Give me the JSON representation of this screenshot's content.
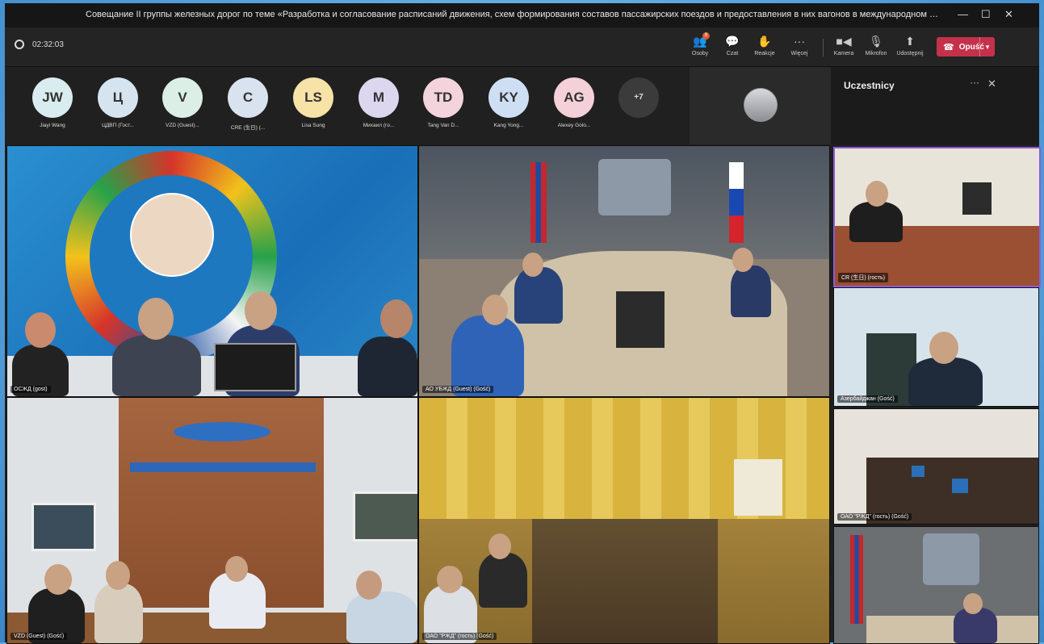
{
  "window": {
    "title": "Совещание II группы железных дорог по теме «Разработка и согласование расписаний движения, схем формирования составов пассажирских поездов и предоставления в них вагонов в международном сообщении на..."
  },
  "toolbar": {
    "timer": "02:32:03",
    "people_label": "Osoby",
    "chat_label": "Czat",
    "reactions_label": "Reakcje",
    "more_label": "Więcej",
    "camera_label": "Kamera",
    "mic_label": "Mikrofon",
    "share_label": "Udostępnij",
    "leave_label": "Opuść",
    "people_badge": "8"
  },
  "participants_strip": [
    {
      "initials": "JW",
      "name": "Jiayi Wang",
      "color": "#d9ecef"
    },
    {
      "initials": "Ц",
      "name": "ЦДВП (Гост...",
      "color": "#d6e4ef"
    },
    {
      "initials": "V",
      "name": "VZD (Guest)...",
      "color": "#dcefe6"
    },
    {
      "initials": "C",
      "name": "CRE (生日) (...",
      "color": "#d9e3f0"
    },
    {
      "initials": "LS",
      "name": "Lisa Sung",
      "color": "#f7e2a8"
    },
    {
      "initials": "M",
      "name": "Михаил (го...",
      "color": "#dcd6ef"
    },
    {
      "initials": "TD",
      "name": "Tang Van D...",
      "color": "#f3d3dc"
    },
    {
      "initials": "KY",
      "name": "Kang Yong...",
      "color": "#cfdff3"
    },
    {
      "initials": "AG",
      "name": "Alexey Golo...",
      "color": "#f4d0d8"
    },
    {
      "initials": "+7",
      "name": "",
      "color": "#3b3b3b"
    }
  ],
  "panel": {
    "title": "Uczestnicy"
  },
  "tiles": {
    "osjd": "ОСЖД (gost)",
    "mongolia": "АО УБЖД (Guest) (Gość)",
    "vietnam": "VZD (Guest) (Gość)",
    "russia": "ОАО \"РЖД\" (гость) (Gość)",
    "china": "CR (生日) (гость)",
    "side2": "Азербайджан (Gość)",
    "side3": "ОАО \"РЖД\" (гость) (Gość)"
  }
}
